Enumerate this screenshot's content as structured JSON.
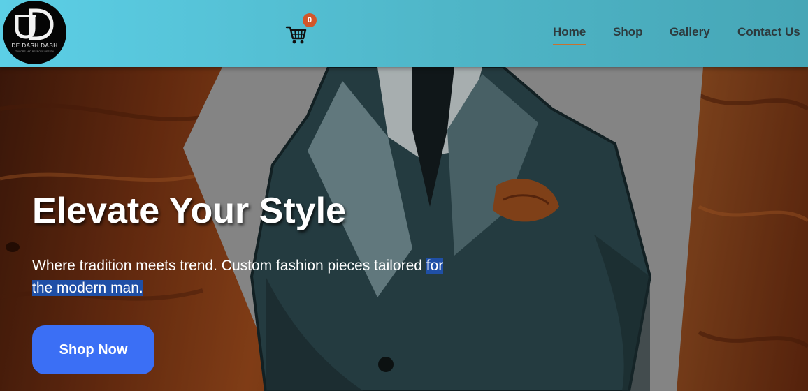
{
  "brand": {
    "logo_name": "DE DASH DASH",
    "logo_tagline": "TAILORS AND BESPOKE DESIGN"
  },
  "header": {
    "cart_icon": "shopping-cart-icon",
    "cart_count": "0",
    "nav": [
      {
        "label": "Home",
        "active": true
      },
      {
        "label": "Shop",
        "active": false
      },
      {
        "label": "Gallery",
        "active": false
      },
      {
        "label": "Contact Us",
        "active": false
      }
    ]
  },
  "hero": {
    "title": "Elevate Your Style",
    "subtitle_main": "Where tradition meets trend. Custom fashion pieces tailored ",
    "subtitle_highlight": "for the modern man.",
    "cta_label": "Shop Now",
    "image": "suit-illustration"
  },
  "colors": {
    "header_gradient_start": "#5ccfe6",
    "header_gradient_end": "#46a6b6",
    "nav_active_underline": "#c9712e",
    "cart_badge": "#d2562a",
    "cta_button": "#3b6ff5",
    "text_highlight": "#1f4fa6"
  }
}
